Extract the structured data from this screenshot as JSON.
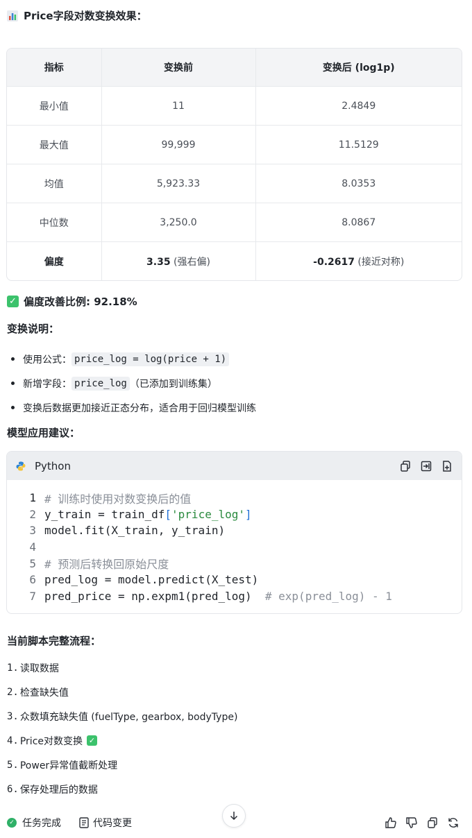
{
  "header": {
    "icon": "bar-chart-icon",
    "title": "Price字段对数变换效果："
  },
  "table": {
    "columns": [
      "指标",
      "变换前",
      "变换后 (log1p)"
    ],
    "rows": [
      {
        "metric": "最小值",
        "before": "11",
        "after": "2.4849"
      },
      {
        "metric": "最大值",
        "before": "99,999",
        "after": "11.5129"
      },
      {
        "metric": "均值",
        "before": "5,923.33",
        "after": "8.0353"
      },
      {
        "metric": "中位数",
        "before": "3,250.0",
        "after": "8.0867"
      }
    ],
    "skew_row": {
      "metric": "偏度",
      "before_value": "3.35",
      "before_note": " (强右偏)",
      "after_value": "-0.2617",
      "after_note": " (接近对称)"
    }
  },
  "improvement": {
    "icon": "check-mark-icon",
    "text": "偏度改善比例: 92.18%"
  },
  "explain": {
    "title": "变换说明：",
    "items": [
      {
        "label": "使用公式：",
        "code": "price_log = log(price + 1)",
        "suffix": ""
      },
      {
        "label": "新增字段：",
        "code": "price_log",
        "suffix": "（已添加到训练集）"
      },
      {
        "label": "变换后数据更加接近正态分布，适合用于回归模型训练",
        "code": "",
        "suffix": ""
      }
    ]
  },
  "model_title": "模型应用建议：",
  "code_block": {
    "language": "Python",
    "lines": [
      {
        "n": "1",
        "t": "# 训练时使用对数变换后的值"
      },
      {
        "n": "2",
        "t": "y_train = train_df['price_log']"
      },
      {
        "n": "3",
        "t": "model.fit(X_train, y_train)"
      },
      {
        "n": "4",
        "t": ""
      },
      {
        "n": "5",
        "t": "# 预测后转换回原始尺度"
      },
      {
        "n": "6",
        "t": "pred_log = model.predict(X_test)"
      },
      {
        "n": "7",
        "t": "pred_price = np.expm1(pred_log)  # exp(pred_log) - 1"
      }
    ]
  },
  "flow": {
    "title": "当前脚本完整流程：",
    "steps": [
      {
        "n": "1.",
        "text": "读取数据"
      },
      {
        "n": "2.",
        "text": "检查缺失值"
      },
      {
        "n": "3.",
        "text": "众数填充缺失值 (fuelType, gearbox, bodyType)"
      },
      {
        "n": "4.",
        "text": "Price对数变换"
      },
      {
        "n": "5.",
        "text": "Power异常值截断处理"
      },
      {
        "n": "6.",
        "text": "保存处理后的数据"
      }
    ]
  },
  "footer": {
    "task_done": "任务完成",
    "code_changes": "代码变更"
  }
}
